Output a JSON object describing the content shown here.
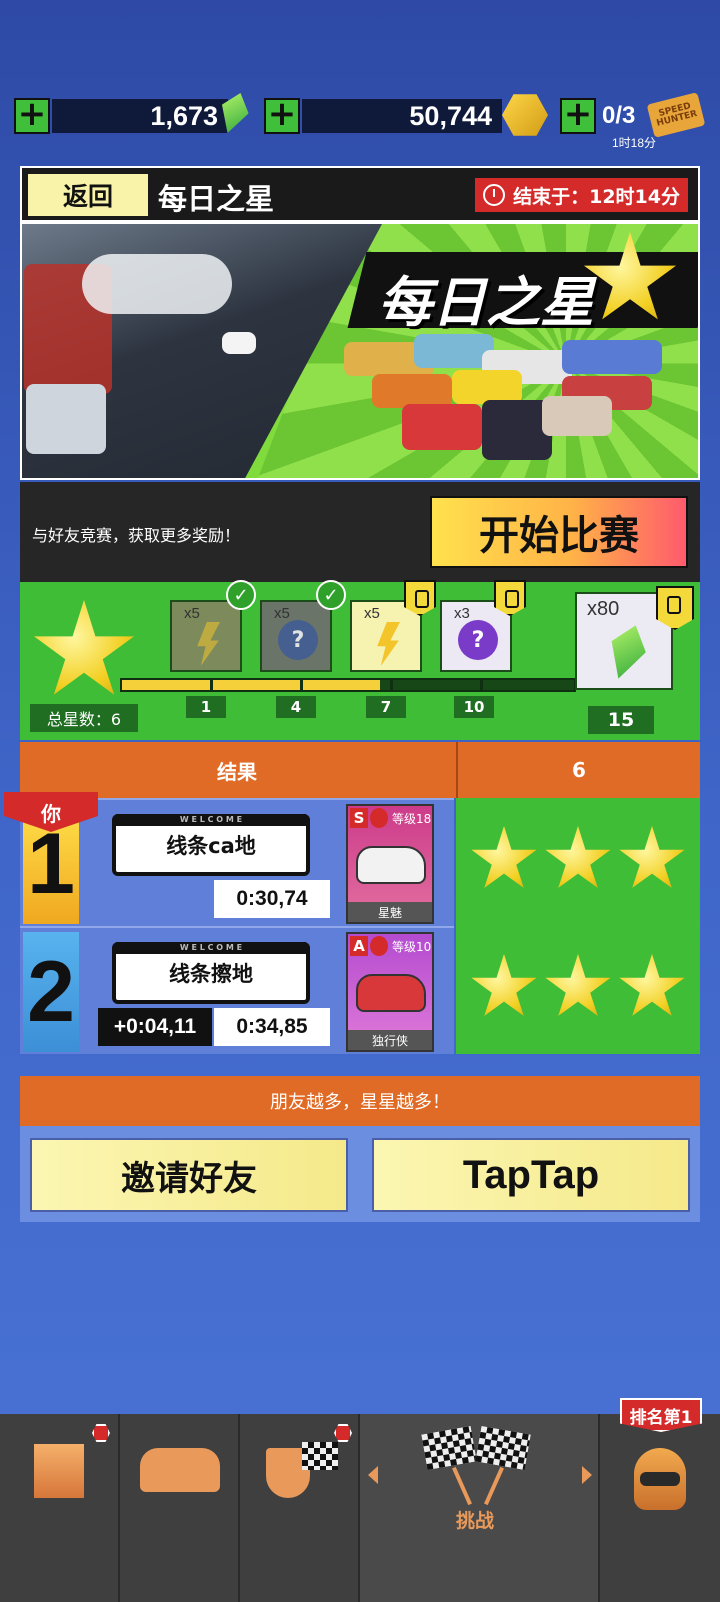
{
  "currency": {
    "gems": "1,673",
    "coins": "50,744",
    "tickets": "0/3",
    "ticket_timer": "1时18分",
    "ticket_logo": "SPEED HUNTER"
  },
  "header": {
    "back_label": "返回",
    "title": "每日之星",
    "timer_label": "结束于：",
    "timer_value": "12时14分"
  },
  "banner": {
    "title": "每日之星"
  },
  "start": {
    "description": "与好友竞赛，获取更多奖励！",
    "button_label": "开始比赛"
  },
  "progress": {
    "total_stars_label": "总星数：6",
    "fill_fraction": 0.57,
    "rewards": [
      {
        "mult": "x5",
        "type": "bolt",
        "milestone": "1",
        "state": "claimed"
      },
      {
        "mult": "x5",
        "type": "mystery",
        "milestone": "4",
        "state": "claimed"
      },
      {
        "mult": "x5",
        "type": "bolt",
        "milestone": "7",
        "state": "locked"
      },
      {
        "mult": "x3",
        "type": "mystery",
        "milestone": "10",
        "state": "locked"
      }
    ],
    "final_reward": {
      "mult": "x80",
      "type": "gem",
      "milestone": "15",
      "state": "locked"
    }
  },
  "results": {
    "col_result": "结果",
    "col_stars": "6",
    "you_label": "你",
    "rows": [
      {
        "rank": "1",
        "name": "线条ca地",
        "time": "0:30,74",
        "diff": "",
        "car_class": "S",
        "car_level": "等级18",
        "car_name": "星魅",
        "stars": 3
      },
      {
        "rank": "2",
        "name": "线条擦地",
        "time": "0:34,85",
        "diff": "+0:04,11",
        "car_class": "A",
        "car_level": "等级10",
        "car_name": "独行侠",
        "stars": 3
      }
    ]
  },
  "invite": {
    "header": "朋友越多，星星越多！",
    "invite_label": "邀请好友",
    "taptap_label": "TapTap"
  },
  "nav": {
    "challenge_label": "挑战",
    "rank_tag": "排名第1"
  },
  "colors": {
    "accent_orange": "#e06b26",
    "green": "#3fbd36",
    "red": "#d42a2a",
    "yellow": "#f5d03a"
  }
}
